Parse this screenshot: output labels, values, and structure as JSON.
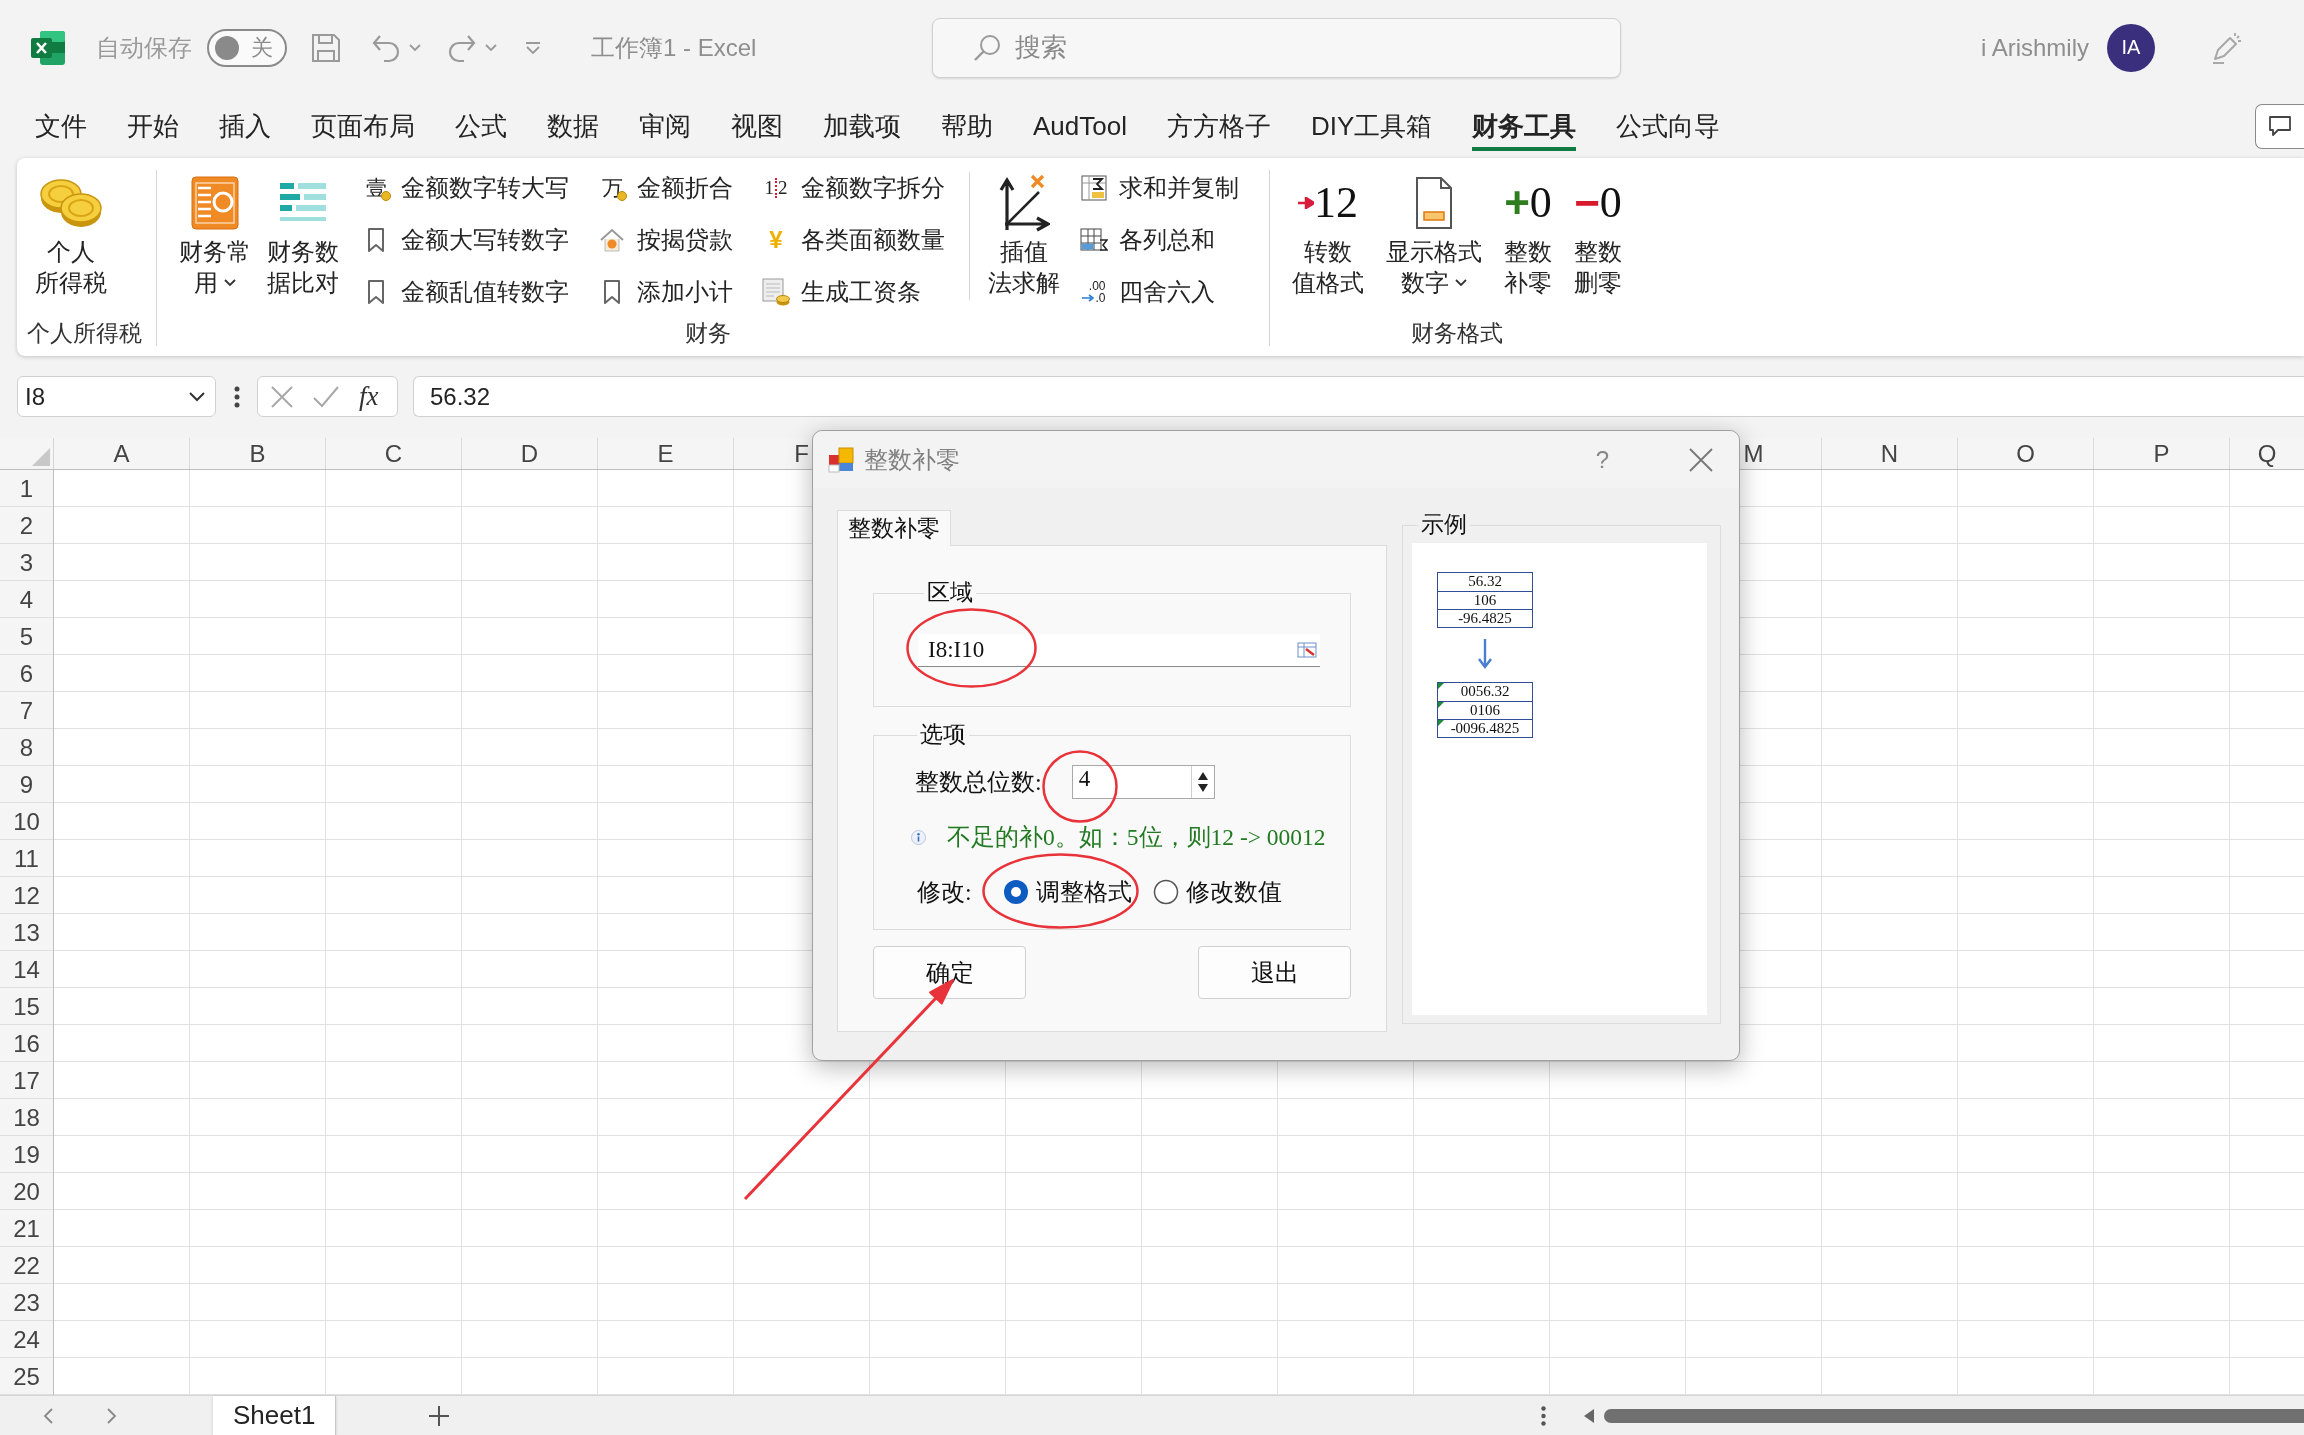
{
  "title_bar": {
    "autosave_label": "自动保存",
    "autosave": {
      "on": false,
      "text": "关"
    },
    "title": "工作簿1 - Excel",
    "search": {
      "placeholder": "搜索"
    },
    "user_name": "i Arishmily",
    "avatar_initials": "IA"
  },
  "menu_tabs": [
    {
      "label": "文件",
      "selected": false
    },
    {
      "label": "开始",
      "selected": false
    },
    {
      "label": "插入",
      "selected": false
    },
    {
      "label": "页面布局",
      "selected": false
    },
    {
      "label": "公式",
      "selected": false
    },
    {
      "label": "数据",
      "selected": false
    },
    {
      "label": "审阅",
      "selected": false
    },
    {
      "label": "视图",
      "selected": false
    },
    {
      "label": "加载项",
      "selected": false
    },
    {
      "label": "帮助",
      "selected": false
    },
    {
      "label": "AudTool",
      "selected": false
    },
    {
      "label": "方方格子",
      "selected": false
    },
    {
      "label": "DIY工具箱",
      "selected": false
    },
    {
      "label": "财务工具",
      "selected": true
    },
    {
      "label": "公式向导",
      "selected": false
    }
  ],
  "ribbon": {
    "groups": [
      {
        "label": "个人所得税",
        "items": [
          {
            "kind": "large",
            "lines": [
              "个人",
              "所得税"
            ],
            "dropdown": false
          }
        ]
      },
      {
        "label": "财务",
        "items": [
          {
            "kind": "large",
            "lines": [
              "财务常",
              "用"
            ],
            "dropdown": true
          },
          {
            "kind": "large",
            "lines": [
              "财务数",
              "据比对"
            ],
            "dropdown": false
          },
          {
            "kind": "column",
            "buttons": [
              {
                "label": "金额数字转大写",
                "icon_text": [
                  "壹"
                ]
              },
              {
                "label": "金额大写转数字"
              },
              {
                "label": "金额乱值转数字"
              }
            ]
          },
          {
            "kind": "column",
            "buttons": [
              {
                "label": "金额折合",
                "icon_text": [
                  "万"
                ]
              },
              {
                "label": "按揭贷款"
              },
              {
                "label": "添加小计"
              }
            ]
          },
          {
            "kind": "column",
            "buttons": [
              {
                "label": "金额数字拆分",
                "icon_text": [
                  "1",
                  "2"
                ]
              },
              {
                "label": "各类面额数量",
                "icon_text": [
                  "¥"
                ]
              },
              {
                "label": "生成工资条"
              }
            ]
          },
          {
            "kind": "separator"
          },
          {
            "kind": "large",
            "lines": [
              "插值",
              "法求解"
            ],
            "dropdown": false
          },
          {
            "kind": "column",
            "buttons": [
              {
                "label": "求和并复制"
              },
              {
                "label": "各列总和"
              },
              {
                "label": "四舍六入",
                "icon_text": [
                  ".00",
                  ".0"
                ]
              }
            ]
          }
        ]
      },
      {
        "label": "财务格式",
        "items": [
          {
            "kind": "large",
            "lines": [
              "转数",
              "值格式"
            ],
            "dropdown": false,
            "icon_text": [
              "12"
            ]
          },
          {
            "kind": "large",
            "lines": [
              "显示格式",
              "数字"
            ],
            "dropdown": true
          },
          {
            "kind": "large",
            "lines": [
              "整数",
              "补零"
            ],
            "dropdown": false,
            "icon_text": [
              "+",
              "0"
            ]
          },
          {
            "kind": "large",
            "lines": [
              "整数",
              "删零"
            ],
            "dropdown": false,
            "icon_text": [
              "−",
              "0"
            ]
          }
        ]
      }
    ]
  },
  "formula_bar": {
    "name_box": "I8",
    "function_label": "fx",
    "value": "56.32"
  },
  "sheet": {
    "columns_left": [
      "A",
      "B",
      "C",
      "D",
      "E",
      "F"
    ],
    "columns_right": [
      "M",
      "N",
      "O",
      "P",
      "Q"
    ],
    "rows": [
      "1",
      "2",
      "3",
      "4",
      "5",
      "6",
      "7",
      "8",
      "9",
      "10",
      "11",
      "12",
      "13",
      "14",
      "15",
      "16",
      "17",
      "18",
      "19",
      "20",
      "21",
      "22",
      "23",
      "24",
      "25"
    ]
  },
  "dialog": {
    "title": "整数补零",
    "help": "?",
    "tabs": [
      {
        "label": "整数补零",
        "selected": true
      }
    ],
    "range_group": {
      "label": "区域",
      "value": "I8:I10",
      "highlighted": true
    },
    "options_group": {
      "label": "选项",
      "digits_label": "整数总位数:",
      "digits_value": "4",
      "digits_highlighted": true,
      "hint": "不足的补0。如：5位，则12 -> 00012",
      "modify_label": "修改:",
      "modes": [
        {
          "label": "调整格式",
          "selected": true,
          "highlighted": true
        },
        {
          "label": "修改数值",
          "selected": false,
          "highlighted": false
        }
      ]
    },
    "buttons": [
      {
        "label": "确定",
        "pointed_at": true
      },
      {
        "label": "退出",
        "pointed_at": false
      }
    ],
    "example": {
      "label": "示例",
      "before": [
        "56.32",
        "106",
        "-96.4825"
      ],
      "after": [
        "0056.32",
        "0106",
        "-0096.4825"
      ]
    }
  },
  "sheet_tabs": [
    {
      "label": "Sheet1",
      "selected": true
    }
  ]
}
